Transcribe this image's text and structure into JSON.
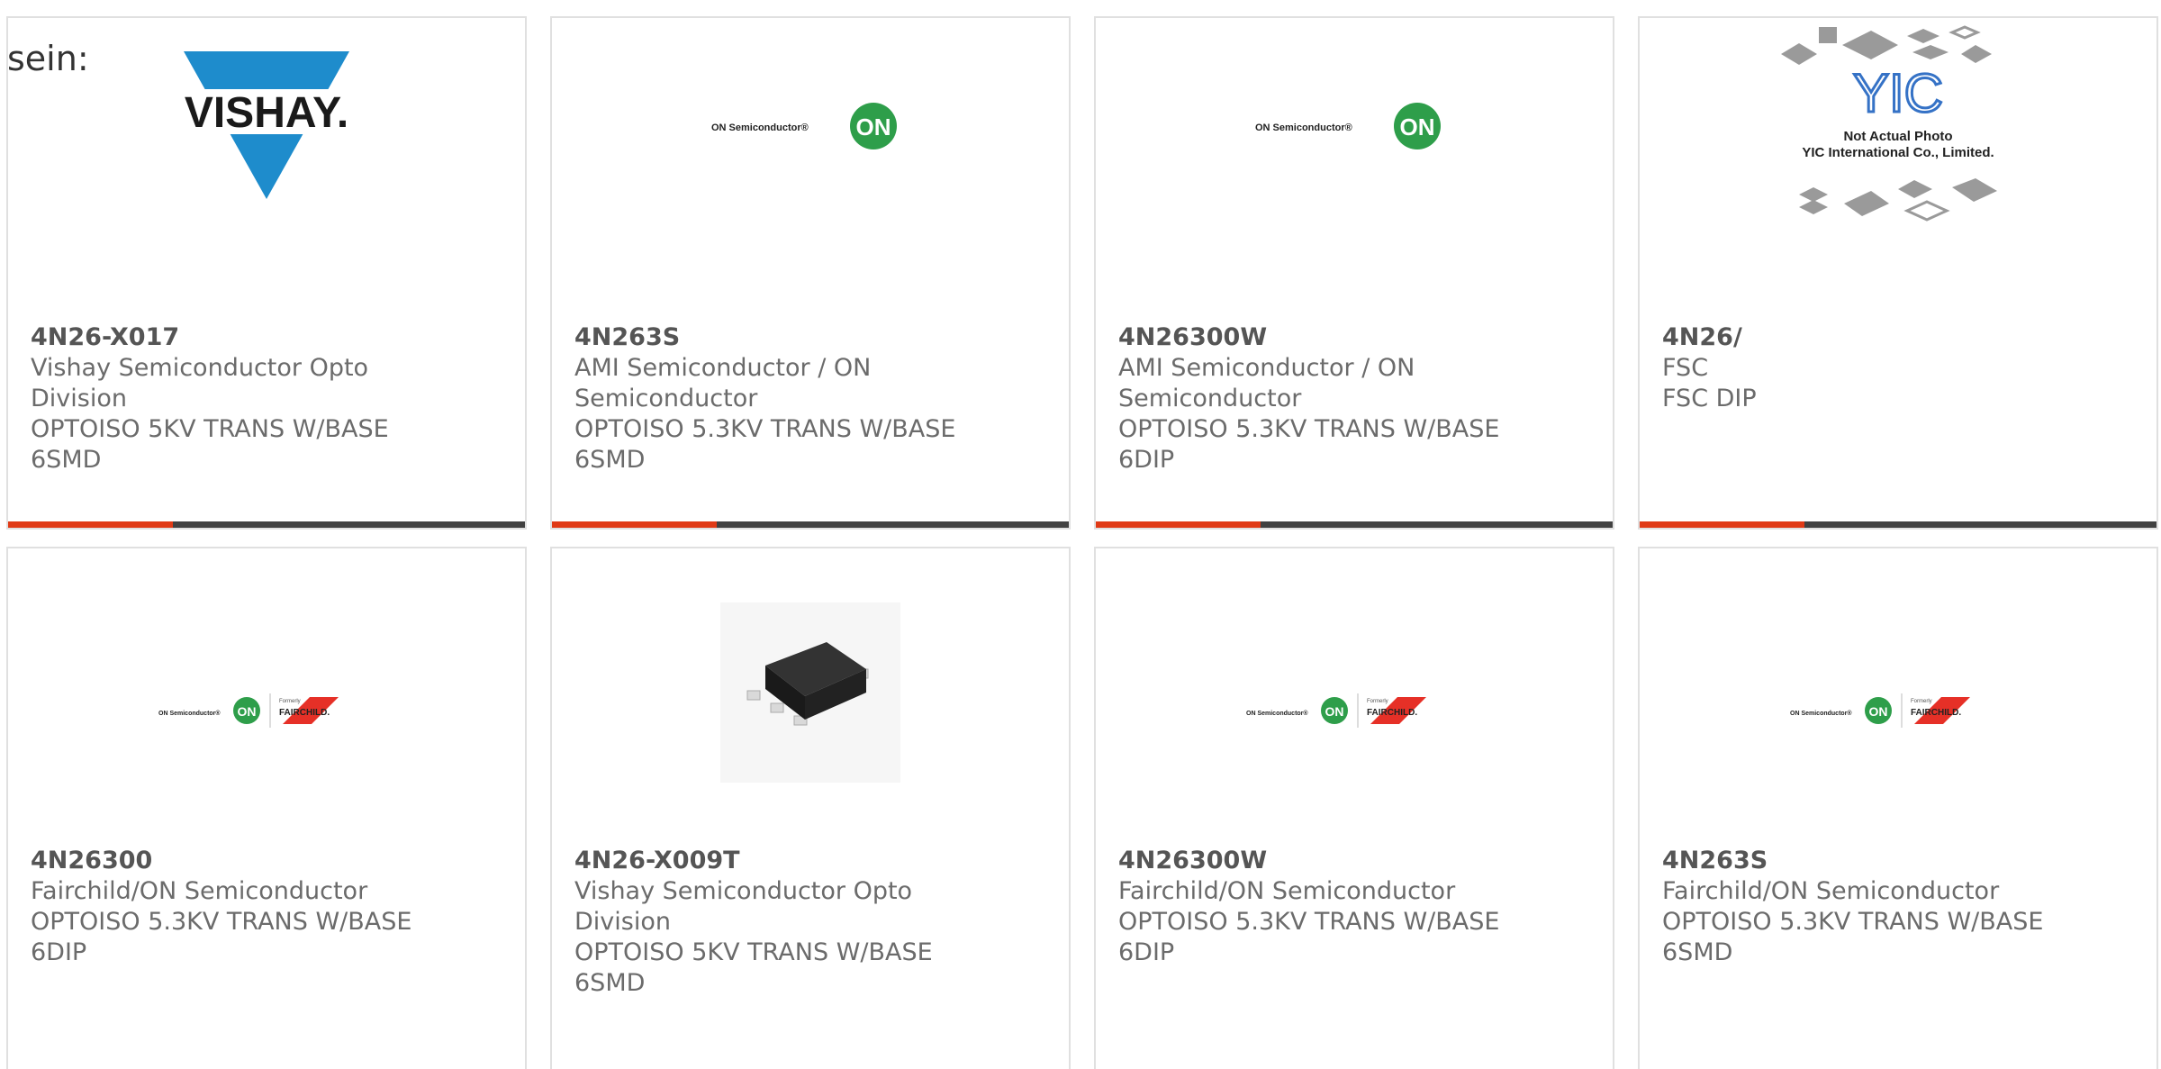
{
  "intro_text": "sein:",
  "colors": {
    "accent": "#e03a16",
    "bar": "#414141",
    "border": "#e0e0e0",
    "text": "#6b6b6b"
  },
  "cards": [
    {
      "part": "4N26-X017",
      "maker_line1": "Vishay Semiconductor Opto",
      "maker_line2": "Division",
      "desc_line1": "OPTOISO 5KV TRANS W/BASE",
      "desc_line2": "6SMD",
      "logo": "vishay-logo",
      "logo_text": "VISHAY."
    },
    {
      "part": "4N263S",
      "maker_line1": "AMI Semiconductor / ON",
      "maker_line2": "Semiconductor",
      "desc_line1": "OPTOISO 5.3KV TRANS W/BASE",
      "desc_line2": "6SMD",
      "logo": "on-semiconductor-logo",
      "logo_text": "ON Semiconductor®",
      "logo_badge": "ON"
    },
    {
      "part": "4N26300W",
      "maker_line1": "AMI Semiconductor / ON",
      "maker_line2": "Semiconductor",
      "desc_line1": "OPTOISO 5.3KV TRANS W/BASE",
      "desc_line2": "6DIP",
      "logo": "on-semiconductor-logo",
      "logo_text": "ON Semiconductor®",
      "logo_badge": "ON"
    },
    {
      "part": "4N26/",
      "maker_line1": "FSC",
      "maker_line2": "",
      "desc_line1": "FSC DIP",
      "desc_line2": "",
      "logo": "yic-not-actual-photo",
      "logo_text": "YIC",
      "logo_caption1": "Not Actual Photo",
      "logo_caption2": "YIC International Co., Limited."
    },
    {
      "part": "4N26300",
      "maker_line1": "Fairchild/ON Semiconductor",
      "maker_line2": "",
      "desc_line1": "OPTOISO 5.3KV TRANS W/BASE",
      "desc_line2": "6DIP",
      "logo": "on-fairchild-logo",
      "logo_text": "ON Semiconductor®",
      "logo_badge": "ON",
      "logo_formerly": "Formerly",
      "logo_fairchild": "FAIRCHILD."
    },
    {
      "part": "4N26-X009T",
      "maker_line1": "Vishay Semiconductor Opto",
      "maker_line2": "Division",
      "desc_line1": "OPTOISO 5KV TRANS W/BASE",
      "desc_line2": "6SMD",
      "logo": "smd-chip-photo"
    },
    {
      "part": "4N26300W",
      "maker_line1": "Fairchild/ON Semiconductor",
      "maker_line2": "",
      "desc_line1": "OPTOISO 5.3KV TRANS W/BASE",
      "desc_line2": "6DIP",
      "logo": "on-fairchild-logo",
      "logo_text": "ON Semiconductor®",
      "logo_badge": "ON",
      "logo_formerly": "Formerly",
      "logo_fairchild": "FAIRCHILD."
    },
    {
      "part": "4N263S",
      "maker_line1": "Fairchild/ON Semiconductor",
      "maker_line2": "",
      "desc_line1": "OPTOISO 5.3KV TRANS W/BASE",
      "desc_line2": "6SMD",
      "logo": "on-fairchild-logo",
      "logo_text": "ON Semiconductor®",
      "logo_badge": "ON",
      "logo_formerly": "Formerly",
      "logo_fairchild": "FAIRCHILD."
    }
  ]
}
